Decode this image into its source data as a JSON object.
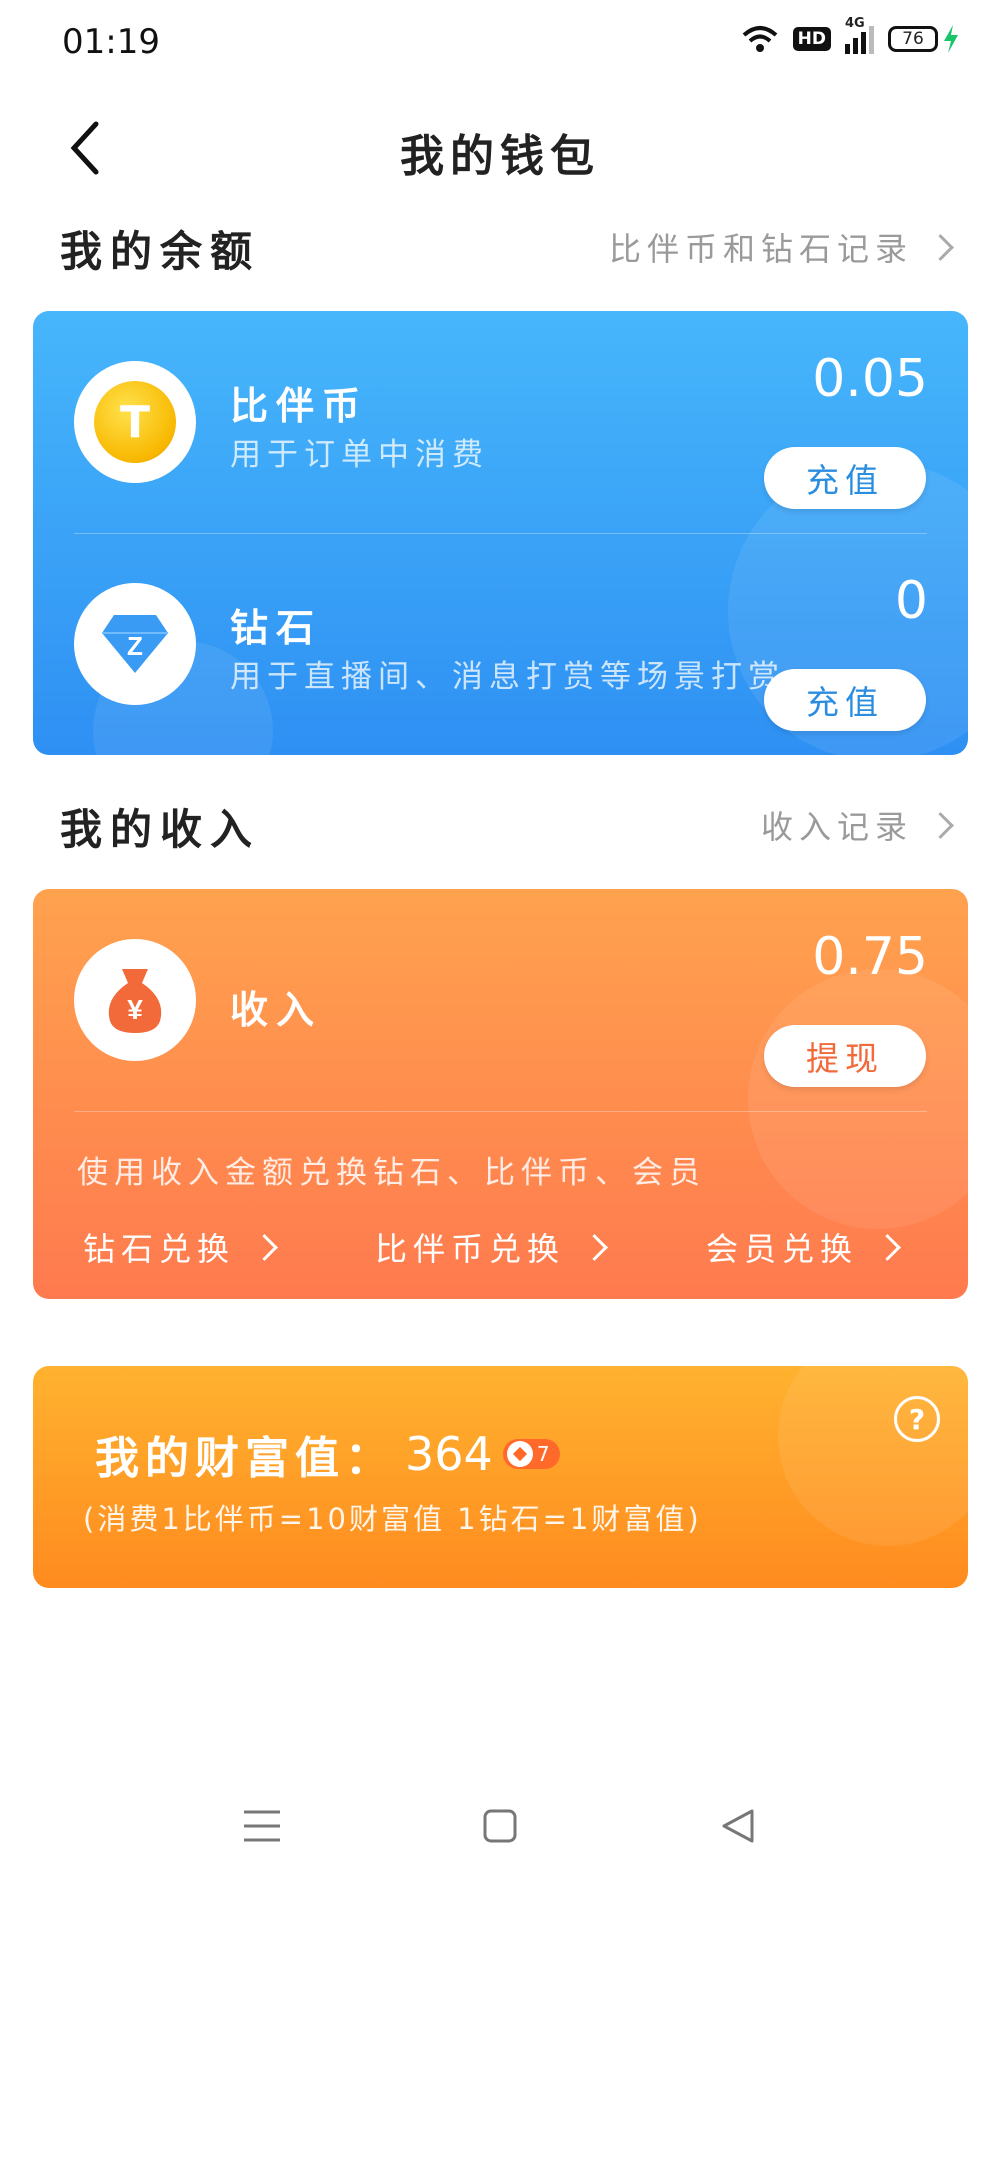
{
  "status_bar": {
    "time": "01:19",
    "network": "4G",
    "hd": "HD",
    "battery": "76"
  },
  "header": {
    "title": "我的钱包"
  },
  "balance_section": {
    "title": "我的余额",
    "link": "比伴币和钻石记录"
  },
  "balance_items": [
    {
      "icon_text": "T",
      "name": "比伴币",
      "desc": "用于订单中消费",
      "value": "0.05",
      "button": "充值"
    },
    {
      "icon_text": "Z",
      "name": "钻石",
      "desc": "用于直播间、消息打赏等场景打赏",
      "value": "0",
      "button": "充值"
    }
  ],
  "income_section": {
    "title": "我的收入",
    "link": "收入记录"
  },
  "income": {
    "icon_text": "¥",
    "name": "收入",
    "value": "0.75",
    "button": "提现",
    "note": "使用收入金额兑换钻石、比伴币、会员",
    "exchanges": [
      "钻石兑换",
      "比伴币兑换",
      "会员兑换"
    ]
  },
  "wealth": {
    "label": "我的财富值：",
    "value": "364",
    "level": "7",
    "note": "(消费1比伴币=10财富值 1钻石=1财富值)",
    "help": "?"
  },
  "colors": {
    "balance_card": "#3aa2f7",
    "income_card": "#ff8c4f",
    "wealth_card": "#ff9e26",
    "balance_btn_text": "#2a8de0",
    "income_btn_text": "#f26a3a"
  }
}
